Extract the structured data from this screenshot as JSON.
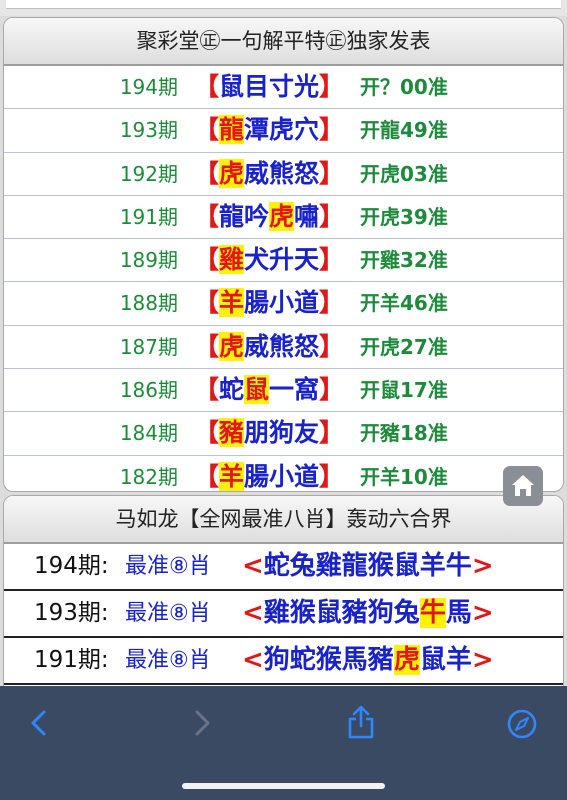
{
  "panel1": {
    "title": "聚彩堂㊣一句解平特㊣独家发表",
    "rows": [
      {
        "period": "194期",
        "pre": "",
        "hl": "",
        "post": "鼠目寸光",
        "result": "开？00准"
      },
      {
        "period": "193期",
        "pre": "",
        "hl": "龍",
        "post": "潭虎穴",
        "result": "开龍49准"
      },
      {
        "period": "192期",
        "pre": "",
        "hl": "虎",
        "post": "威熊怒",
        "result": "开虎03准"
      },
      {
        "period": "191期",
        "pre": "龍吟",
        "hl": "虎",
        "post": "嘯",
        "result": "开虎39准"
      },
      {
        "period": "189期",
        "pre": "",
        "hl": "雞",
        "post": "犬升天",
        "result": "开雞32准"
      },
      {
        "period": "188期",
        "pre": "",
        "hl": "羊",
        "post": "腸小道",
        "result": "开羊46准"
      },
      {
        "period": "187期",
        "pre": "",
        "hl": "虎",
        "post": "威熊怒",
        "result": "开虎27准"
      },
      {
        "period": "186期",
        "pre": "蛇",
        "hl": "鼠",
        "post": "一窩",
        "result": "开鼠17准"
      },
      {
        "period": "184期",
        "pre": "",
        "hl": "豬",
        "post": "朋狗友",
        "result": "开豬18准"
      },
      {
        "period": "182期",
        "pre": "",
        "hl": "羊",
        "post": "腸小道",
        "result": "开羊10准"
      }
    ]
  },
  "panel2": {
    "title": "马如龙【全网最准八肖】轰动六合界",
    "rows": [
      {
        "period": "194期:",
        "label": "最准⑧肖",
        "pre": "蛇兔雞龍猴鼠羊牛",
        "hl": "",
        "post": ""
      },
      {
        "period": "193期:",
        "label": "最准⑧肖",
        "pre": "雞猴鼠豬狗兔",
        "hl": "牛",
        "post": "馬"
      },
      {
        "period": "191期:",
        "label": "最准⑧肖",
        "pre": "狗蛇猴馬豬",
        "hl": "虎",
        "post": "鼠羊"
      }
    ]
  },
  "brackets": {
    "open": "【",
    "close": "】",
    "angle_open": "<",
    "angle_close": ">"
  },
  "icons": {
    "home": "home-icon",
    "back": "chevron-left-icon",
    "forward": "chevron-right-icon",
    "share": "share-icon",
    "safari": "compass-icon"
  },
  "colors": {
    "green": "#1e8a3c",
    "blue": "#1a23c8",
    "red": "#e01818",
    "highlight": "#fff20a",
    "toolbar": "#3b4a63"
  }
}
